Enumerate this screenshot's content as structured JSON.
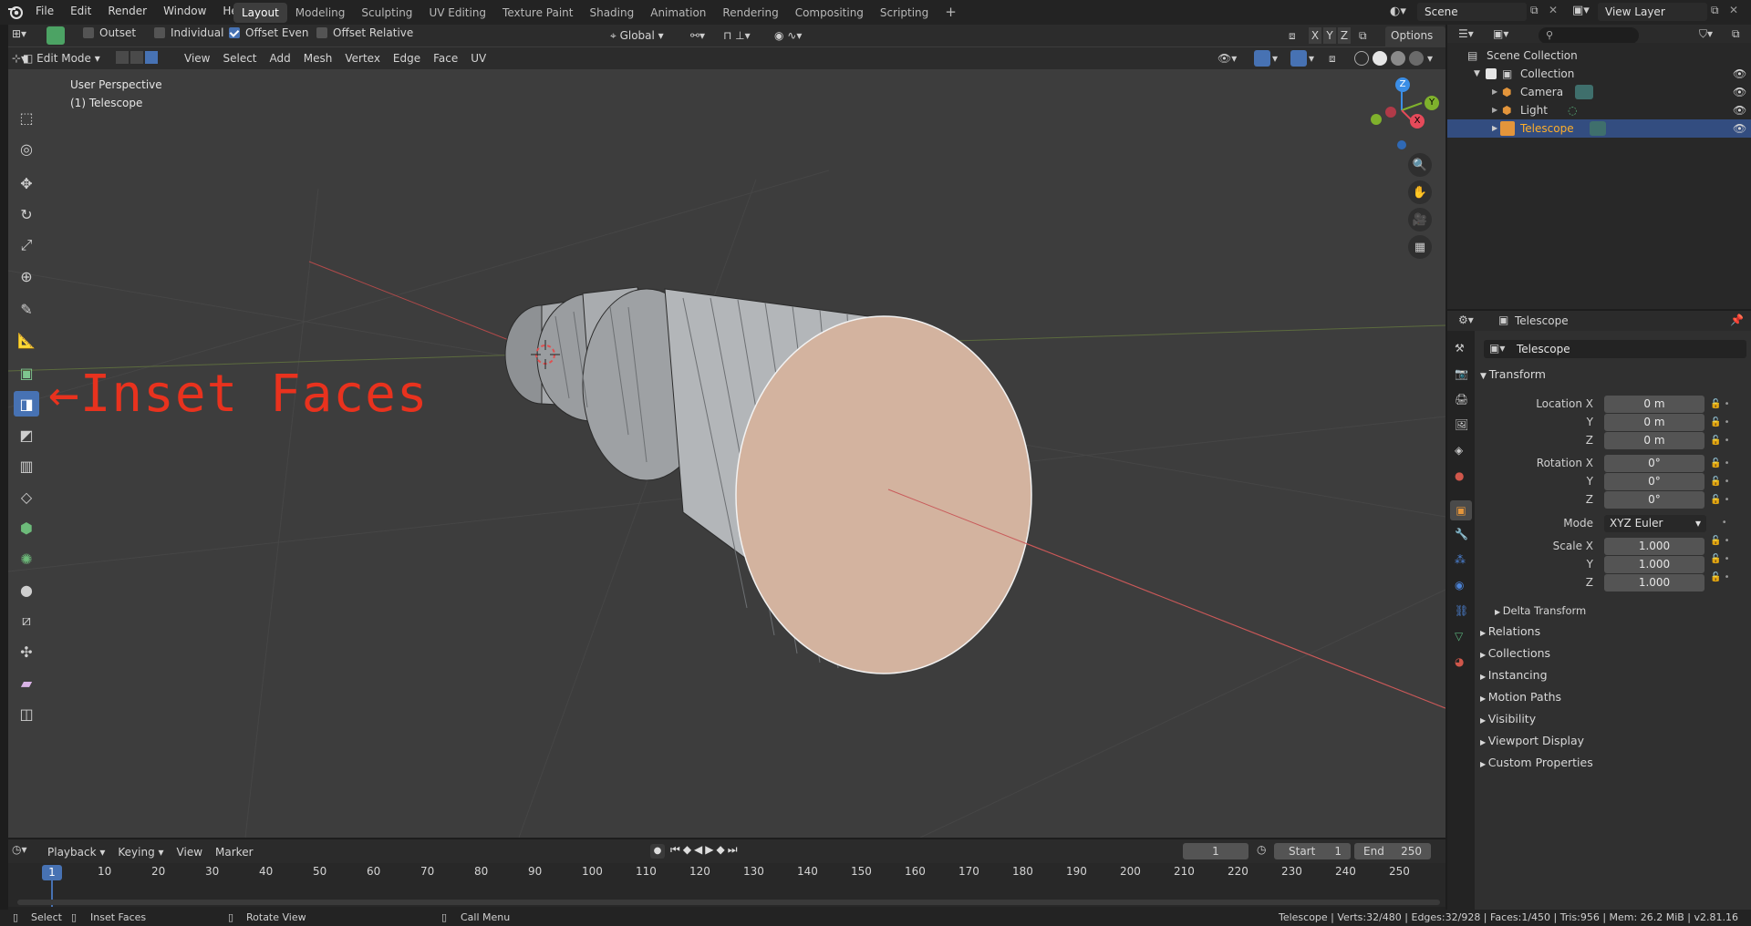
{
  "menubar": {
    "items": [
      "File",
      "Edit",
      "Render",
      "Window",
      "Help"
    ],
    "workspaces": [
      "Layout",
      "Modeling",
      "Sculpting",
      "UV Editing",
      "Texture Paint",
      "Shading",
      "Animation",
      "Rendering",
      "Compositing",
      "Scripting"
    ],
    "active_workspace": "Layout",
    "scene": "Scene",
    "view_layer": "View Layer"
  },
  "tool_header": {
    "outset": "Outset",
    "individual": "Individual",
    "offset_even": "Offset Even",
    "offset_relative": "Offset Relative",
    "orientation": "Global",
    "options": "Options",
    "axis_x": "X",
    "axis_y": "Y",
    "axis_z": "Z"
  },
  "viewport_header": {
    "mode": "Edit Mode",
    "menus": [
      "View",
      "Select",
      "Add",
      "Mesh",
      "Vertex",
      "Edge",
      "Face",
      "UV"
    ]
  },
  "viewport": {
    "perspective": "User Perspective",
    "object_label": "(1) Telescope",
    "annotation": "←Inset Faces",
    "annotation_color": "#e8321e",
    "face_color": "#d3b39f",
    "gizmo": {
      "z": "Z",
      "y": "Y",
      "x": "X"
    }
  },
  "outliner": {
    "scene_collection": "Scene Collection",
    "collection": "Collection",
    "items": [
      "Camera",
      "Light",
      "Telescope"
    ],
    "selected": "Telescope",
    "selected_color": "#ffaf29"
  },
  "properties": {
    "header_object": "Telescope",
    "object_name": "Telescope",
    "transform_title": "Transform",
    "location": {
      "label_x": "Location X",
      "label_y": "Y",
      "label_z": "Z",
      "x": "0 m",
      "y": "0 m",
      "z": "0 m"
    },
    "rotation": {
      "label_x": "Rotation X",
      "label_y": "Y",
      "label_z": "Z",
      "x": "0°",
      "y": "0°",
      "z": "0°"
    },
    "mode_label": "Mode",
    "mode_value": "XYZ Euler",
    "scale": {
      "label_x": "Scale X",
      "label_y": "Y",
      "label_z": "Z",
      "x": "1.000",
      "y": "1.000",
      "z": "1.000"
    },
    "delta_transform": "Delta Transform",
    "panels": [
      "Relations",
      "Collections",
      "Instancing",
      "Motion Paths",
      "Visibility",
      "Viewport Display",
      "Custom Properties"
    ]
  },
  "timeline": {
    "menus": [
      "Playback",
      "Keying",
      "View",
      "Marker"
    ],
    "current_frame": "1",
    "start_label": "Start",
    "start": "1",
    "end_label": "End",
    "end": "250",
    "ticks": [
      "10",
      "20",
      "30",
      "40",
      "50",
      "60",
      "70",
      "80",
      "90",
      "100",
      "110",
      "120",
      "130",
      "140",
      "150",
      "160",
      "170",
      "180",
      "190",
      "200",
      "210",
      "220",
      "230",
      "240",
      "250"
    ],
    "playhead": "1"
  },
  "statusbar": {
    "select": "Select",
    "inset_faces": "Inset Faces",
    "rotate_view": "Rotate View",
    "call_menu": "Call Menu",
    "stats": "Telescope | Verts:32/480 | Edges:32/928 | Faces:1/450 | Tris:956 | Mem: 26.2 MiB | v2.81.16"
  }
}
